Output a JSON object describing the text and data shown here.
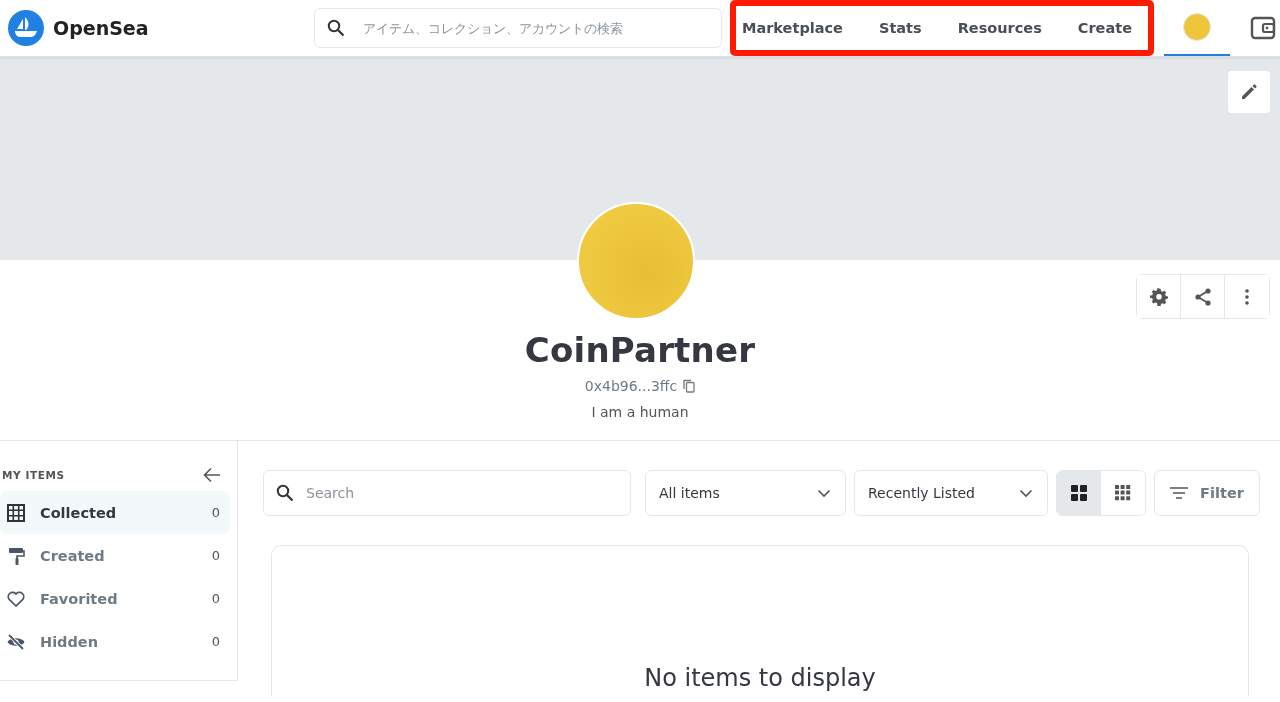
{
  "header": {
    "logo": "OpenSea",
    "search": {
      "placeholder": "アイテム、コレクション、アカウントの検索"
    },
    "nav": [
      {
        "label": "Marketplace"
      },
      {
        "label": "Stats"
      },
      {
        "label": "Resources"
      },
      {
        "label": "Create"
      }
    ],
    "account_tab": {
      "selected": true
    }
  },
  "profile": {
    "name": "CoinPartner",
    "address": "0x4b96...3ffc",
    "bio": "I am a human"
  },
  "sidebar": {
    "title": "MY ITEMS",
    "items": [
      {
        "kind": "collected",
        "label": "Collected",
        "count": "0",
        "selected": true
      },
      {
        "kind": "created",
        "label": "Created",
        "count": "0",
        "selected": false
      },
      {
        "kind": "favorited",
        "label": "Favorited",
        "count": "0",
        "selected": false
      },
      {
        "kind": "hidden",
        "label": "Hidden",
        "count": "0",
        "selected": false
      }
    ]
  },
  "toolbar": {
    "search": {
      "placeholder": "Search"
    },
    "dropdowns": [
      {
        "value": "All items"
      },
      {
        "value": "Recently Listed"
      }
    ],
    "view_modes": [
      {
        "kind": "large",
        "selected": true
      },
      {
        "kind": "small",
        "selected": false
      }
    ],
    "filter": "Filter"
  },
  "empty_message": "No items to display"
}
